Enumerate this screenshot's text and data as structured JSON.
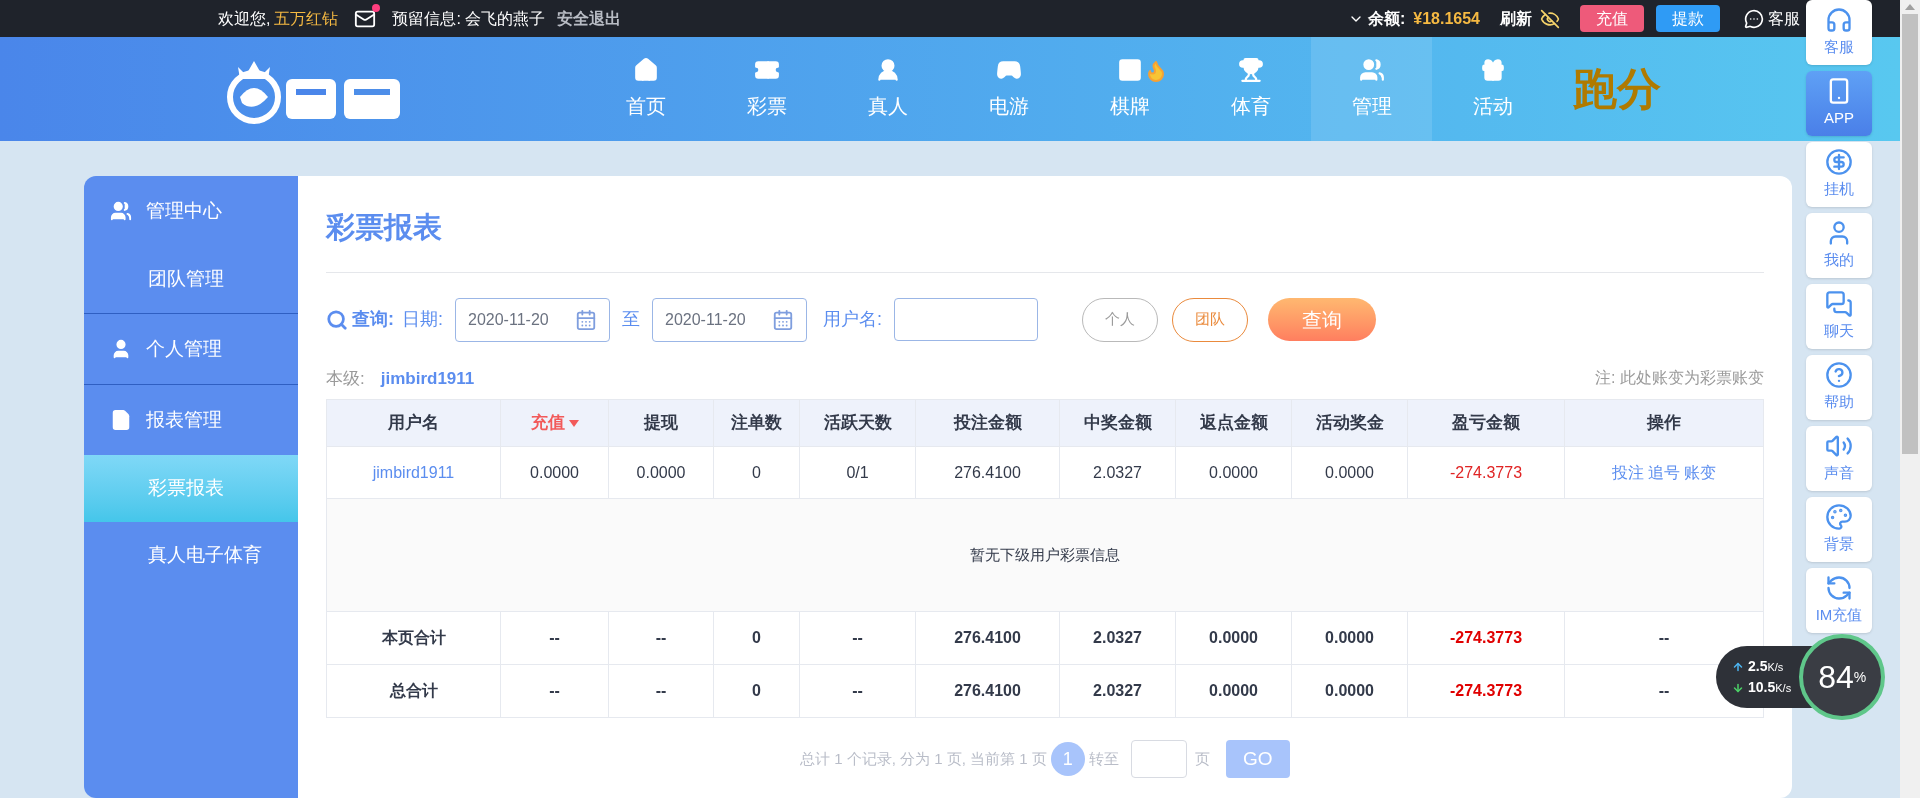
{
  "top_bar": {
    "greeting": "欢迎您,",
    "user_level": "五万红钻",
    "message_label": "预留信息:",
    "message": "会飞的燕子",
    "logout": "安全退出",
    "balance_label": "余额:",
    "balance": "¥18.1654",
    "refresh": "刷新",
    "recharge": "充值",
    "withdraw": "提款",
    "service": "客服"
  },
  "nav": {
    "items": [
      {
        "label": "首页",
        "selected": false
      },
      {
        "label": "彩票",
        "selected": false
      },
      {
        "label": "真人",
        "selected": false
      },
      {
        "label": "电游",
        "selected": false
      },
      {
        "label": "棋牌",
        "selected": false
      },
      {
        "label": "体育",
        "selected": false
      },
      {
        "label": "管理",
        "selected": true
      },
      {
        "label": "活动",
        "selected": false
      }
    ],
    "extra": "跑分"
  },
  "sidebar": {
    "groups": [
      {
        "label": "管理中心",
        "children": [
          {
            "label": "团队管理",
            "selected": false
          }
        ]
      },
      {
        "label": "个人管理"
      },
      {
        "label": "报表管理",
        "children": [
          {
            "label": "彩票报表",
            "selected": true
          },
          {
            "label": "真人电子体育",
            "selected": false
          }
        ]
      }
    ]
  },
  "content": {
    "title": "彩票报表",
    "filter": {
      "query_label": "查询:",
      "date_label": "日期:",
      "date_from": "2020-11-20",
      "to_label": "至",
      "date_to": "2020-11-20",
      "username_label": "用户名:",
      "scopes": [
        {
          "label": "个人",
          "selected": false
        },
        {
          "label": "团队",
          "selected": true
        }
      ],
      "submit": "查询"
    },
    "level_label": "本级:",
    "level_user": "jimbird1911",
    "note": "注: 此处账变为彩票账变",
    "table": {
      "columns": [
        {
          "label": "用户名",
          "sorted": false
        },
        {
          "label": "充值",
          "sorted": true
        },
        {
          "label": "提现",
          "sorted": false
        },
        {
          "label": "注单数",
          "sorted": false
        },
        {
          "label": "活跃天数",
          "sorted": false
        },
        {
          "label": "投注金额",
          "sorted": false
        },
        {
          "label": "中奖金额",
          "sorted": false
        },
        {
          "label": "返点金额",
          "sorted": false
        },
        {
          "label": "活动奖金",
          "sorted": false
        },
        {
          "label": "盈亏金额",
          "sorted": false
        },
        {
          "label": "操作",
          "sorted": false
        }
      ],
      "rows": [
        {
          "kind": "data",
          "cells": [
            "jimbird1911",
            "0.0000",
            "0.0000",
            "0",
            "0/1",
            "276.4100",
            "2.0327",
            "0.0000",
            "0.0000",
            "-274.3773"
          ],
          "actions": [
            "投注",
            "追号",
            "账变"
          ]
        },
        {
          "kind": "empty",
          "message": "暂无下级用户彩票信息"
        },
        {
          "kind": "total",
          "cells": [
            "本页合计",
            "--",
            "--",
            "0",
            "--",
            "276.4100",
            "2.0327",
            "0.0000",
            "0.0000",
            "-274.3773",
            "--"
          ]
        },
        {
          "kind": "total",
          "cells": [
            "总合计",
            "--",
            "--",
            "0",
            "--",
            "276.4100",
            "2.0327",
            "0.0000",
            "0.0000",
            "-274.3773",
            "--"
          ]
        }
      ]
    },
    "pagination": {
      "summary": "总计 1 个记录, 分为 1 页, 当前第 1 页",
      "pages": [
        {
          "label": "1",
          "selected": true
        }
      ],
      "goto_label": "转至",
      "page_unit": "页",
      "go": "GO"
    }
  },
  "side_panel": {
    "items": [
      {
        "label": "客服",
        "selected": false
      },
      {
        "label": "APP",
        "selected": true
      },
      {
        "label": "挂机",
        "selected": false
      },
      {
        "label": "我的",
        "selected": false
      },
      {
        "label": "聊天",
        "selected": false
      },
      {
        "label": "帮助",
        "selected": false
      },
      {
        "label": "声音",
        "selected": false
      },
      {
        "label": "背景",
        "selected": false
      },
      {
        "label": "IM充值",
        "selected": false
      }
    ]
  },
  "speed_widget": {
    "upload": "2.5",
    "upload_unit": "K/s",
    "download": "10.5",
    "download_unit": "K/s",
    "percent": "84",
    "percent_unit": "%"
  }
}
